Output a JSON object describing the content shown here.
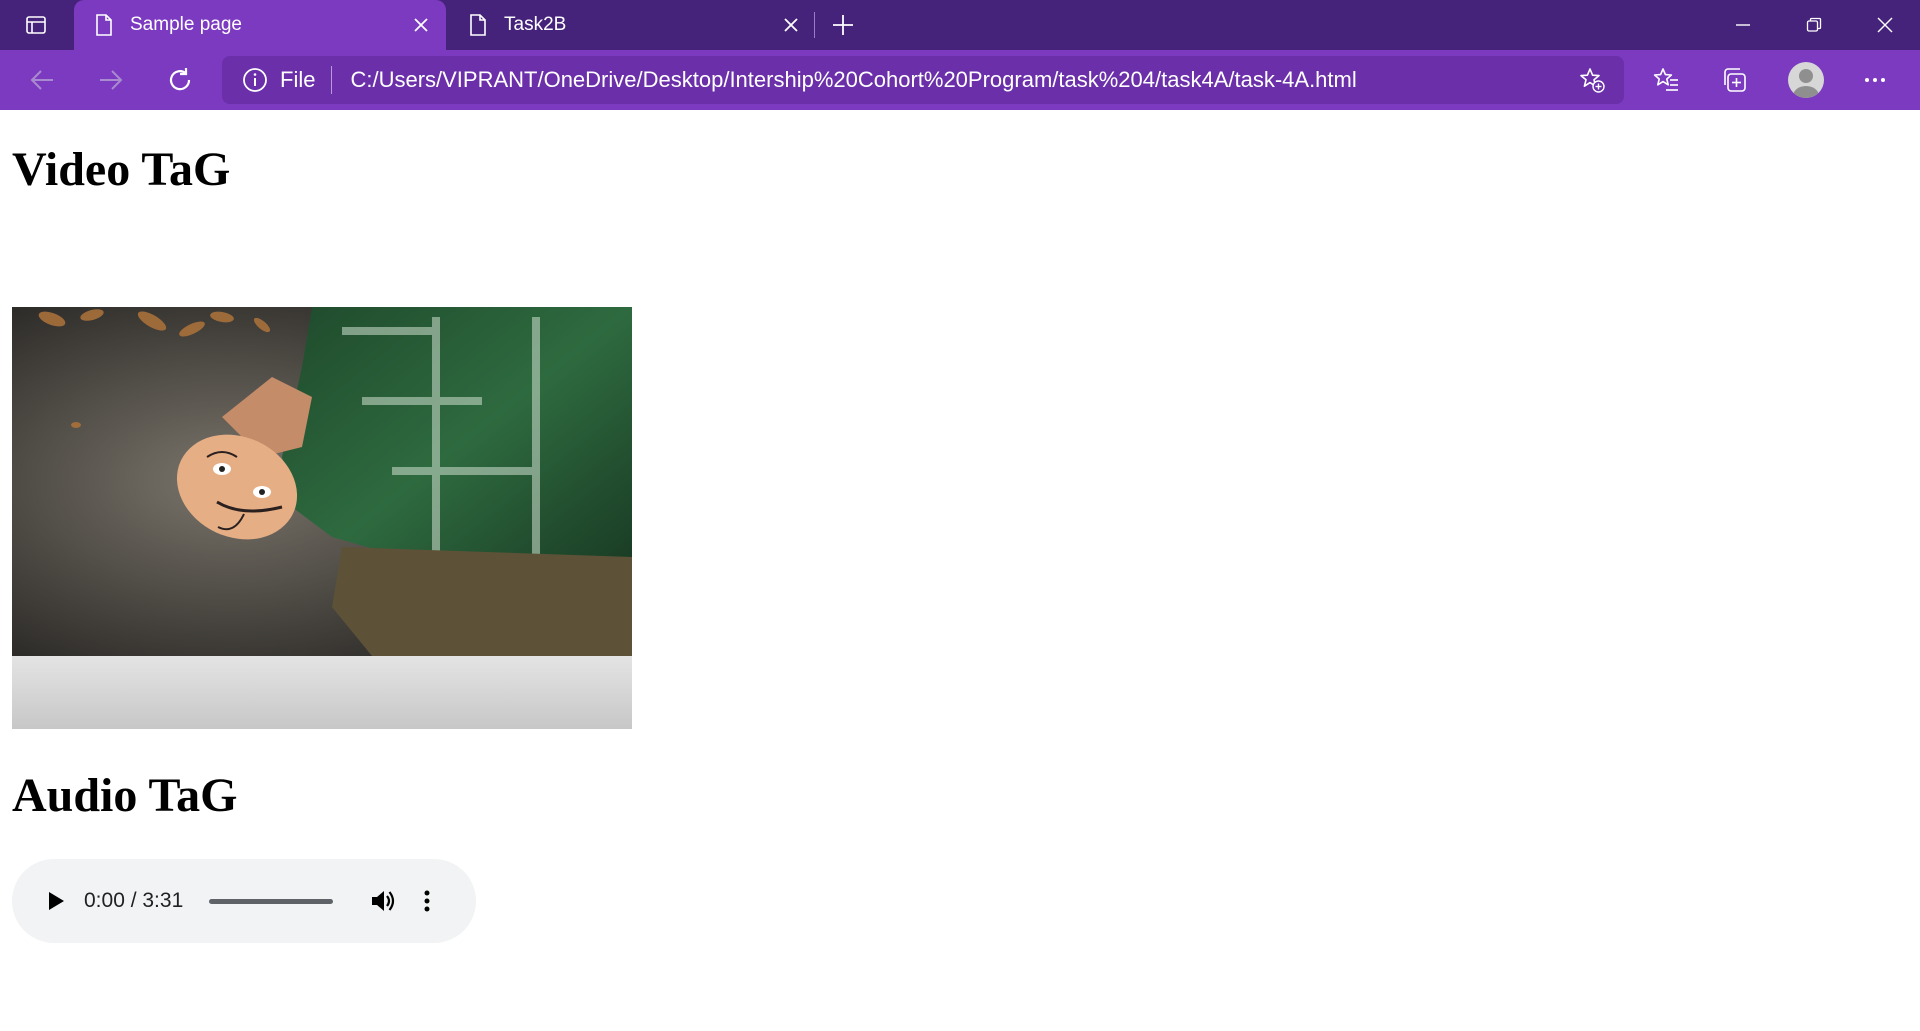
{
  "browser": {
    "tabs": [
      {
        "label": "Sample page",
        "active": true,
        "icon": "page-icon"
      },
      {
        "label": "Task2B",
        "active": false,
        "icon": "page-icon"
      }
    ],
    "address": {
      "info_label": "File",
      "url": "C:/Users/VIPRANT/OneDrive/Desktop/Intership%20Cohort%20Program/task%204/task4A/task-4A.html"
    },
    "colors": {
      "tabbar": "#46237a",
      "toolbar": "#7b3ac0",
      "active_tab": "#7b3ac0"
    }
  },
  "page": {
    "video_heading": "Video TaG",
    "audio_heading": "Audio TaG",
    "audio_player": {
      "time_display": "0:00 / 3:31"
    }
  }
}
